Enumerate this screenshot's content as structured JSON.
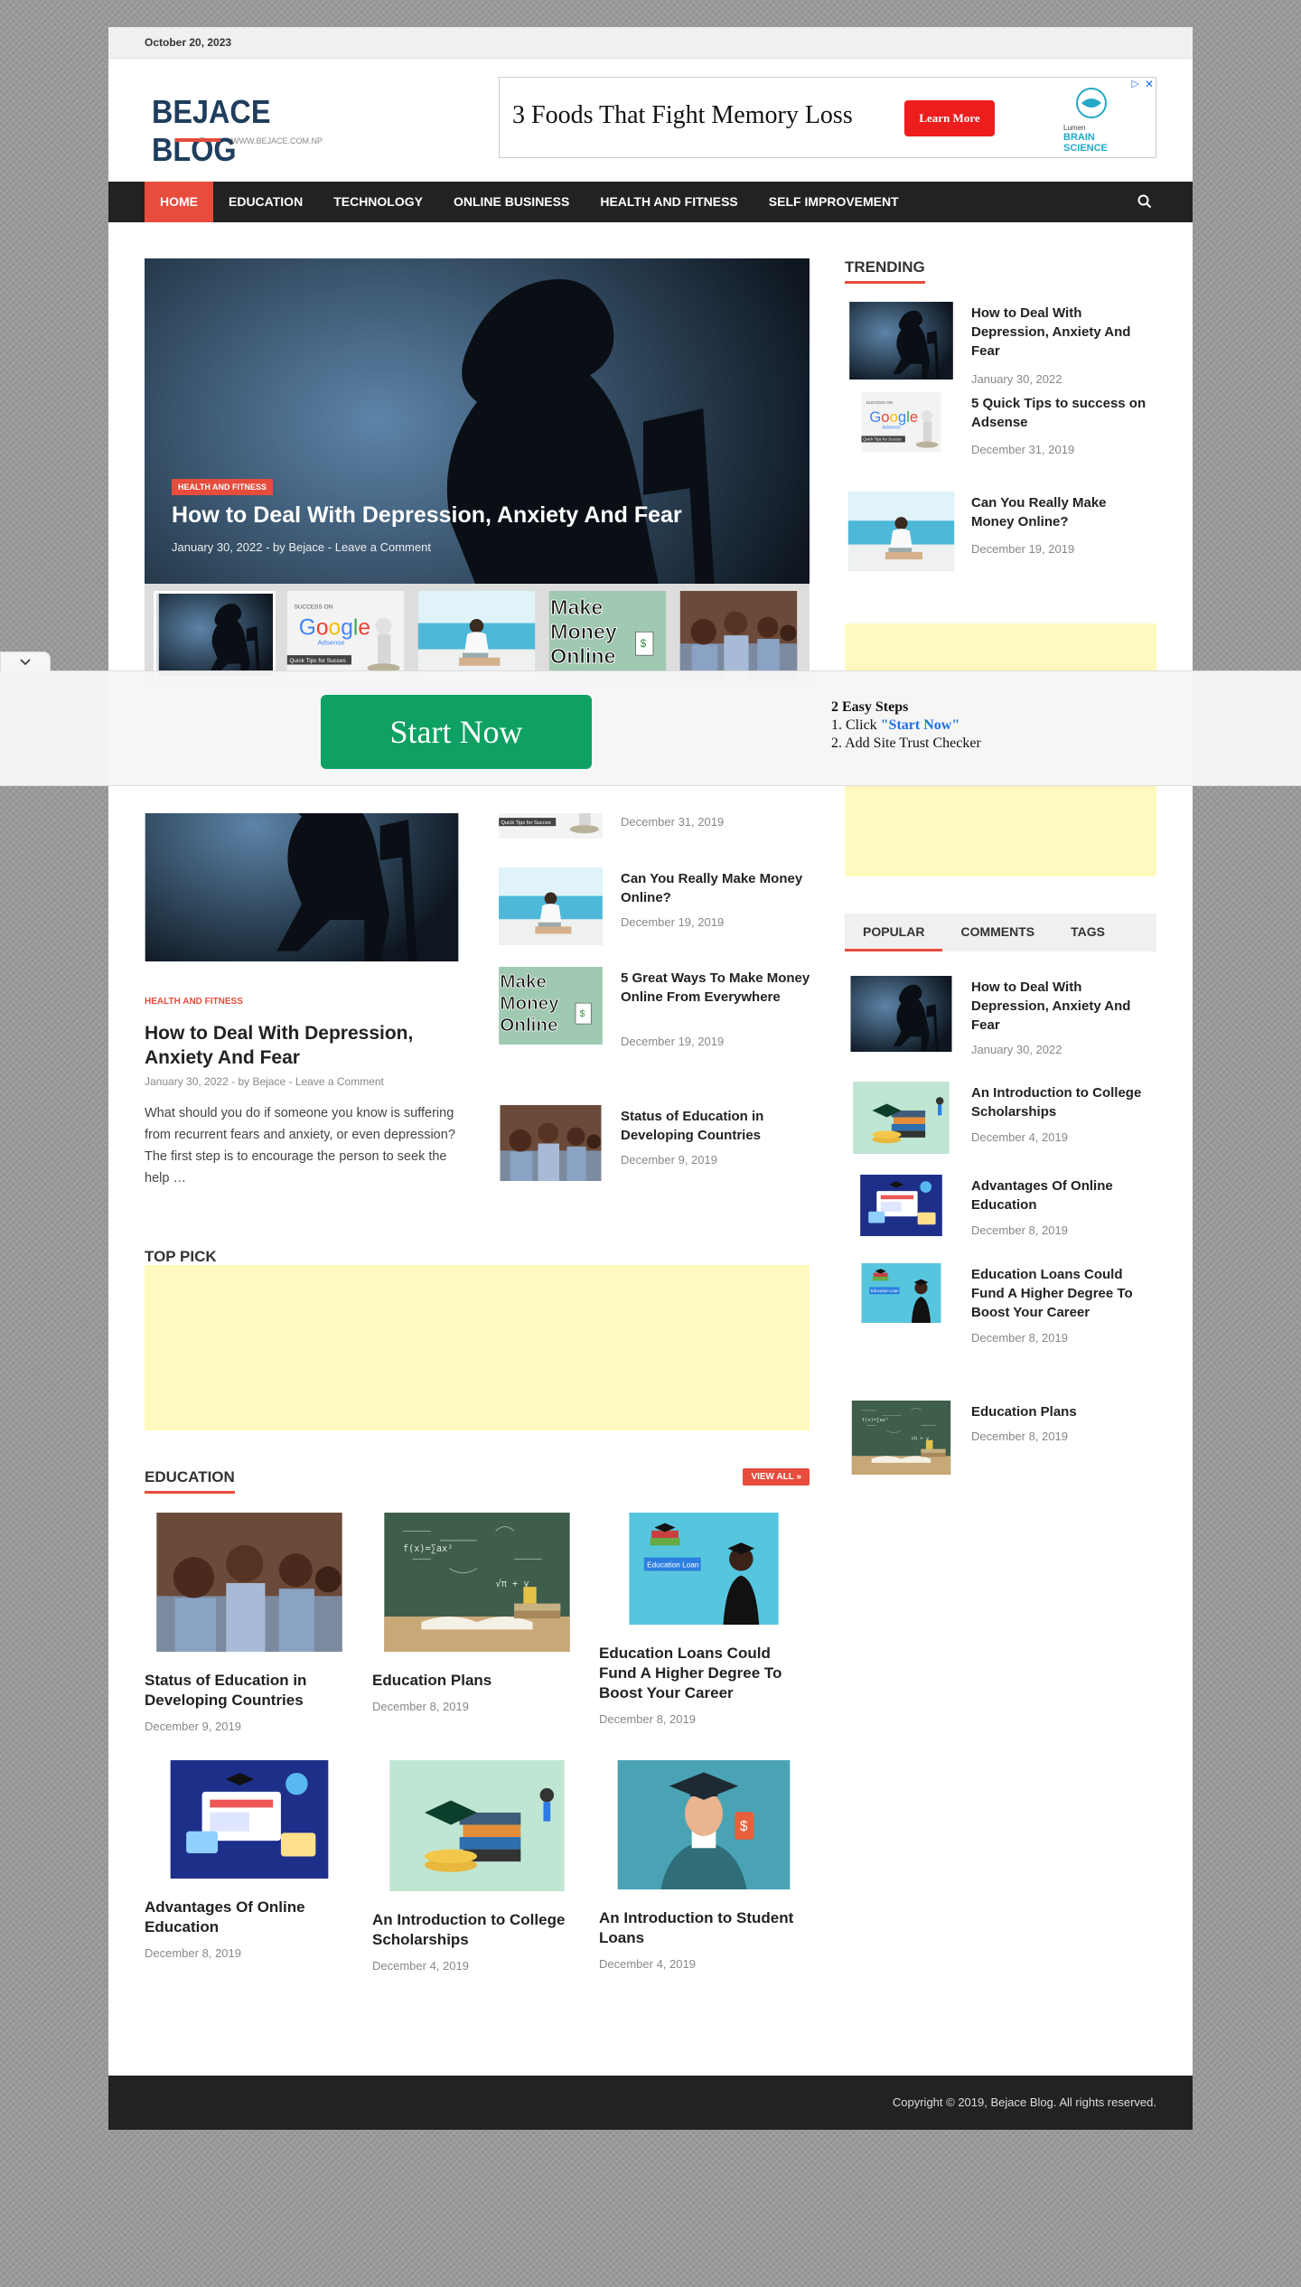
{
  "topbar": {
    "date": "October 20, 2023"
  },
  "logo": {
    "title": "BEJACE BLOG",
    "subtitle": "WWW.BEJACE.COM.NP"
  },
  "header_ad": {
    "headline": "3 Foods That Fight Memory Loss",
    "button": "Learn More",
    "brand": "BRAIN SCIENCE"
  },
  "nav": {
    "items": [
      "HOME",
      "EDUCATION",
      "TECHNOLOGY",
      "ONLINE BUSINESS",
      "HEALTH AND FITNESS",
      "SELF IMPROVEMENT"
    ]
  },
  "hero": {
    "category": "HEALTH AND FITNESS",
    "title": "How to Deal With Depression, Anxiety And Fear",
    "date": "January 30, 2022",
    "author": "by Bejace",
    "comment": "Leave a Comment"
  },
  "trending": {
    "title": "TRENDING",
    "items": [
      {
        "title": "How to Deal With Depression, Anxiety And Fear",
        "date": "January 30, 2022",
        "image": "depression"
      },
      {
        "title": "5 Quick Tips to success on Adsense",
        "date": "December 31, 2019",
        "image": "adsense"
      },
      {
        "title": "Can You Really Make Money Online?",
        "date": "December 19, 2019",
        "image": "laptop-pool"
      }
    ]
  },
  "overlay": {
    "button": "Start Now",
    "steps_title": "2 Easy Steps",
    "step1_prefix": "1. Click ",
    "step1_link": "\"Start Now\"",
    "step2": "2. Add Site Trust Checker"
  },
  "featured": {
    "category": "HEALTH AND FITNESS",
    "title": "How to Deal With Depression, Anxiety And Fear",
    "date": "January 30, 2022",
    "author": "by Bejace",
    "comment": "Leave a Comment",
    "excerpt": "What should you do if someone you know is suffering from recurrent fears and anxiety, or even depression? The first step is to encourage the person to seek the help …"
  },
  "midlist": [
    {
      "title": "",
      "date": "December 31, 2019"
    },
    {
      "title": "Can You Really Make Money Online?",
      "date": "December 19, 2019"
    },
    {
      "title": "5 Great Ways To Make Money Online From Everywhere",
      "date": "December 19, 2019"
    },
    {
      "title": "Status of Education in Developing Countries",
      "date": "December 9, 2019"
    }
  ],
  "tabs": [
    "POPULAR",
    "COMMENTS",
    "TAGS"
  ],
  "popular": [
    {
      "title": "How to Deal With Depression, Anxiety And Fear",
      "date": "January 30, 2022"
    },
    {
      "title": "An Introduction to College Scholarships",
      "date": "December 4, 2019"
    },
    {
      "title": "Advantages Of Online Education",
      "date": "December 8, 2019"
    },
    {
      "title": "Education Loans Could Fund A Higher Degree To Boost Your Career",
      "date": "December 8, 2019"
    },
    {
      "title": "Education Plans",
      "date": "December 8, 2019"
    }
  ],
  "toppick": {
    "title": "TOP PICK"
  },
  "education": {
    "title": "EDUCATION",
    "view_all": "VIEW ALL »",
    "cards": [
      {
        "title": "Status of Education in Developing Countries",
        "date": "December 9, 2019"
      },
      {
        "title": "Education Plans",
        "date": "December 8, 2019"
      },
      {
        "title": "Education Loans Could Fund A Higher Degree To Boost Your Career",
        "date": "December 8, 2019",
        "badge": "Education Loan"
      },
      {
        "title": "Advantages Of Online Education",
        "date": "December 8, 2019"
      },
      {
        "title": "An Introduction to College Scholarships",
        "date": "December 4, 2019"
      },
      {
        "title": "An Introduction to Student Loans",
        "date": "December 4, 2019"
      }
    ]
  },
  "thumb_labels": {
    "adsense_top": "SUCCESS ON",
    "adsense_google": "Google",
    "adsense_sub": "Adsense",
    "adsense_tip": "Quick Tips for Succes",
    "money": "Make Money Online"
  },
  "footer": {
    "copyright": "Copyright © 2019, Bejace Blog. All rights reserved."
  },
  "colors": {
    "accent": "#e74c3c",
    "nav": "#222222",
    "ad_bg": "#fff9c0",
    "start_button": "#0fa063"
  }
}
